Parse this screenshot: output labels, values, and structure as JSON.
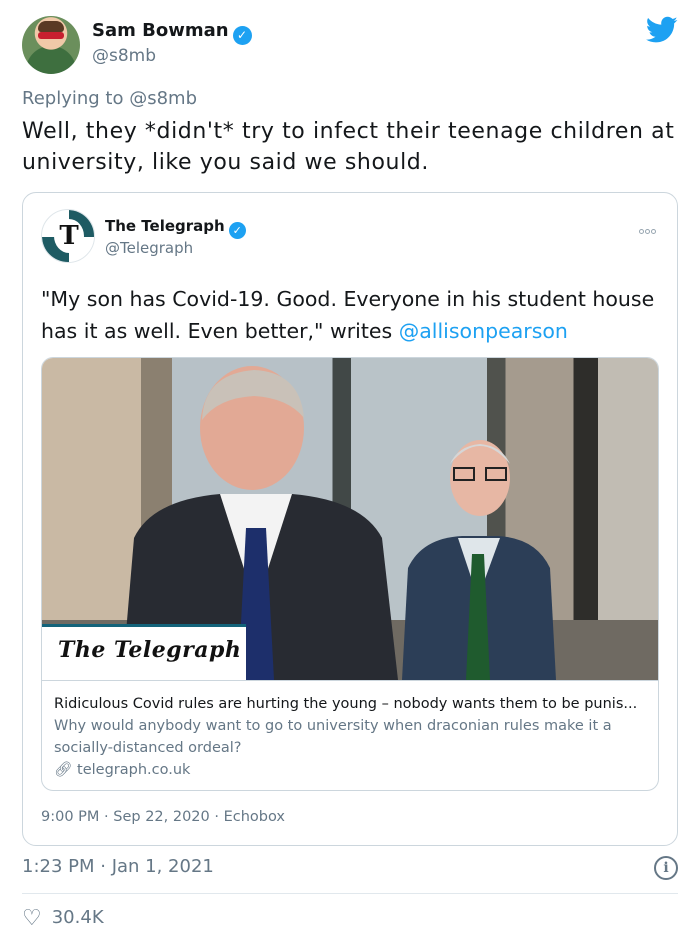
{
  "author": {
    "name": "Sam Bowman",
    "handle": "@s8mb"
  },
  "replying_to": {
    "label": "Replying to",
    "mention": "@s8mb"
  },
  "tweet": {
    "text": "Well, they *didn't* try to infect their teenage children at university, like you said we should.",
    "time": "1:23 PM · Jan 1, 2021",
    "likes": "30.4K"
  },
  "quoted": {
    "name": "The Telegraph",
    "handle": "@Telegraph",
    "text": "\"My son has Covid-19. Good. Everyone in his student house has it as well. Even better,\" writes ",
    "link": "@allisonpearson",
    "meta": "9:00 PM · Sep 22, 2020 · Echobox",
    "card": {
      "banner": "The Telegraph",
      "title": "Ridiculous Covid rules are hurting the young – nobody wants them to be punis...",
      "description": "Why would anybody want to go to university when draconian rules make it a socially-distanced ordeal?",
      "domain": "telegraph.co.uk"
    }
  },
  "icons": {
    "verified": "verified-badge-icon",
    "twitter": "twitter-bird-icon",
    "more": "more-options-icon",
    "link": "link-icon",
    "info": "info-icon",
    "like": "heart-icon"
  },
  "colors": {
    "accent": "#1da1f2",
    "secondary_text": "#657786",
    "border": "#ccd6dd"
  }
}
